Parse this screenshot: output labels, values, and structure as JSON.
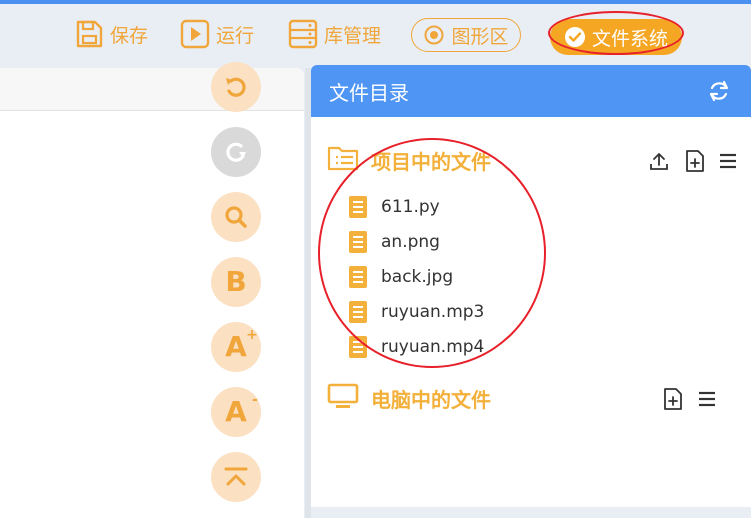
{
  "toolbar": {
    "save_label": "保存",
    "run_label": "运行",
    "library_label": "库管理",
    "graphics_label": "图形区",
    "filesystem_label": "文件系统"
  },
  "side_tools": [
    "undo",
    "redo",
    "search",
    "bold",
    "font-increase",
    "font-decrease",
    "scroll-to-top"
  ],
  "side_tool_letters": {
    "bold": "B",
    "font_up": "A",
    "font_up_sup": "+",
    "font_down": "A",
    "font_down_sup": "-"
  },
  "panel": {
    "title": "文件目录",
    "project_section": {
      "title": "项目中的文件",
      "files": [
        "611.py",
        "an.png",
        "back.jpg",
        "ruyuan.mp3",
        "ruyuan.mp4"
      ]
    },
    "computer_section": {
      "title": "电脑中的文件"
    }
  },
  "colors": {
    "accent": "#f5a623",
    "header_blue": "#4f95f4",
    "annotation_red": "#e8202a",
    "side_button_bg": "#fbe0c2"
  }
}
